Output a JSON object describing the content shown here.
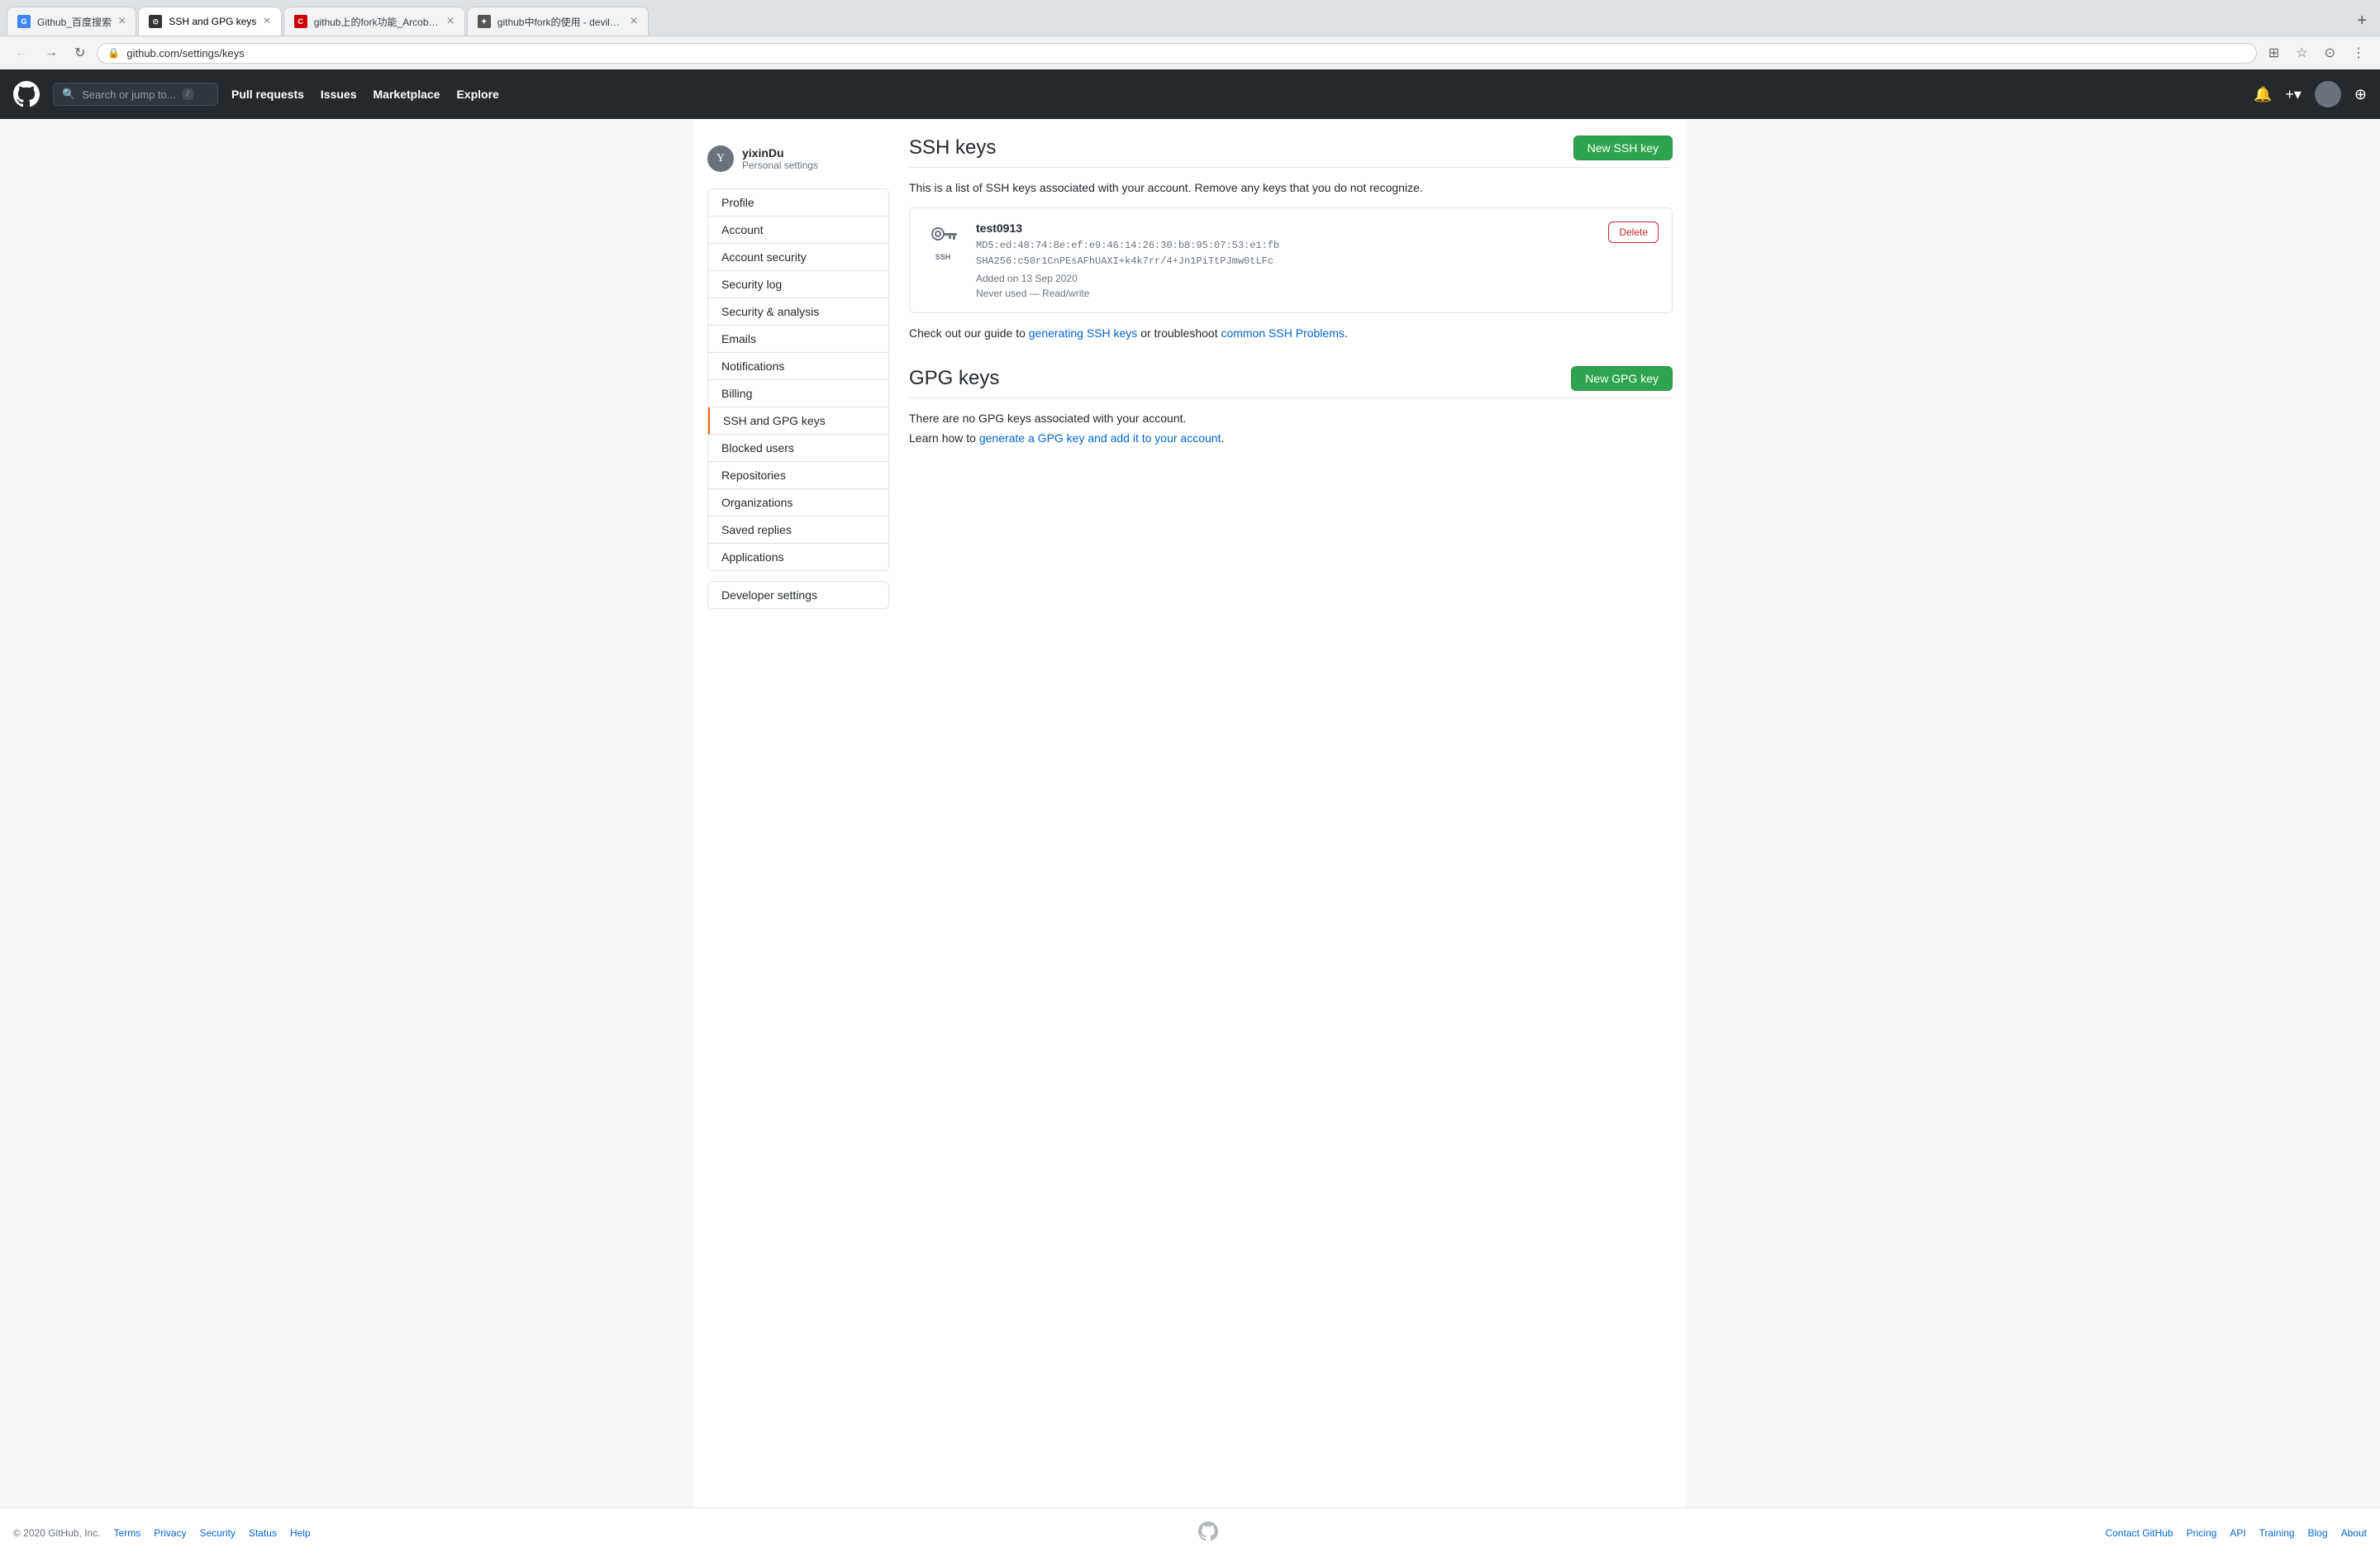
{
  "browser": {
    "tabs": [
      {
        "id": "tab1",
        "favicon_color": "#4285f4",
        "favicon_char": "G",
        "title": "Github_百度搜索",
        "active": false
      },
      {
        "id": "tab2",
        "favicon_color": "#333",
        "favicon_char": "⊙",
        "title": "SSH and GPG keys",
        "active": true
      },
      {
        "id": "tab3",
        "favicon_color": "#cc0000",
        "favicon_char": "C",
        "title": "github上的fork功能_Arcobalenc...",
        "active": false
      },
      {
        "id": "tab4",
        "favicon_color": "#555",
        "favicon_char": "✦",
        "title": "github中fork的使用 - devilwind...",
        "active": false
      }
    ],
    "url": "github.com/settings/keys"
  },
  "github_header": {
    "search_placeholder": "Search or jump to...",
    "shortcut": "/",
    "nav_items": [
      "Pull requests",
      "Issues",
      "Marketplace",
      "Explore"
    ]
  },
  "sidebar": {
    "username": "yixinDu",
    "subtitle": "Personal settings",
    "nav_items": [
      {
        "label": "Profile",
        "active": false
      },
      {
        "label": "Account",
        "active": false
      },
      {
        "label": "Account security",
        "active": false
      },
      {
        "label": "Security log",
        "active": false
      },
      {
        "label": "Security & analysis",
        "active": false
      },
      {
        "label": "Emails",
        "active": false
      },
      {
        "label": "Notifications",
        "active": false
      },
      {
        "label": "Billing",
        "active": false
      },
      {
        "label": "SSH and GPG keys",
        "active": true
      },
      {
        "label": "Blocked users",
        "active": false
      },
      {
        "label": "Repositories",
        "active": false
      },
      {
        "label": "Organizations",
        "active": false
      },
      {
        "label": "Saved replies",
        "active": false
      },
      {
        "label": "Applications",
        "active": false
      }
    ],
    "developer_settings": "Developer settings"
  },
  "ssh_section": {
    "title": "SSH keys",
    "new_key_button": "New SSH key",
    "description": "This is a list of SSH keys associated with your account. Remove any keys that you do not recognize.",
    "key": {
      "name": "test0913",
      "md5": "MD5:ed:48:74:8e:ef:e9:46:14:26:30:b8:95:07:53:e1:fb",
      "sha256": "SHA256:c50r1CnPEsAFhUAXI+k4k7rr/4+Jn1PiTtPJmw0tLFc",
      "added_date": "Added on 13 Sep 2020",
      "usage": "Never used — Read/write",
      "delete_button": "Delete"
    },
    "guide_text": "Check out our guide to",
    "guide_link1": "generating SSH keys",
    "guide_mid": "or troubleshoot",
    "guide_link2": "common SSH Problems",
    "guide_end": "."
  },
  "gpg_section": {
    "title": "GPG keys",
    "new_key_button": "New GPG key",
    "empty_text": "There are no GPG keys associated with your account.",
    "learn_text": "Learn how to",
    "learn_link": "generate a GPG key and add it to your account",
    "learn_end": "."
  },
  "footer": {
    "copyright": "© 2020 GitHub, Inc.",
    "links": [
      "Terms",
      "Privacy",
      "Security",
      "Status",
      "Help"
    ],
    "right_links": [
      "Contact GitHub",
      "Pricing",
      "API",
      "Training",
      "Blog",
      "About"
    ]
  }
}
